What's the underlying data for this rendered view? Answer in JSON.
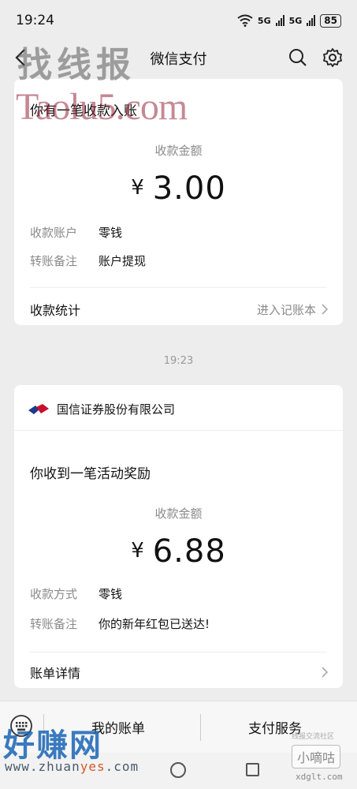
{
  "status": {
    "time": "19:24",
    "network1": "5G",
    "network2": "5G",
    "battery": "85"
  },
  "header": {
    "title": "微信支付"
  },
  "watermarks": {
    "top": "找线报",
    "taolu": "Taolu5.com",
    "bottom": "好赚网",
    "bottom_url_prefix": "www.zhuan",
    "bottom_url_highlight": "yes",
    "bottom_url_suffix": ".com",
    "xdg_box": "小嘀咕",
    "xdg_url": "xdglt.com",
    "xdg_top": "线报交流社区"
  },
  "msg1": {
    "title": "你有一笔收款入账",
    "amount_label": "收款金额",
    "currency": "¥",
    "amount": "3.00",
    "rows": [
      {
        "k": "收款账户",
        "v": "零钱"
      },
      {
        "k": "转账备注",
        "v": "账户提现"
      }
    ],
    "footer_left": "收款统计",
    "footer_right": "进入记账本"
  },
  "time_separator": "19:23",
  "msg2": {
    "company": "国信证券股份有限公司",
    "title": "你收到一笔活动奖励",
    "amount_label": "收款金额",
    "currency": "¥",
    "amount": "6.88",
    "rows": [
      {
        "k": "收款方式",
        "v": "零钱"
      },
      {
        "k": "转账备注",
        "v": "你的新年红包已送达!"
      }
    ],
    "footer_left": "账单详情"
  },
  "bottom_nav": {
    "item1": "我的账单",
    "item2": "支付服务"
  },
  "colors": {
    "background": "#ededed",
    "card": "#ffffff",
    "muted": "#8a8a8a",
    "logo_blue": "#1e3a8a",
    "logo_red": "#c8102e"
  }
}
